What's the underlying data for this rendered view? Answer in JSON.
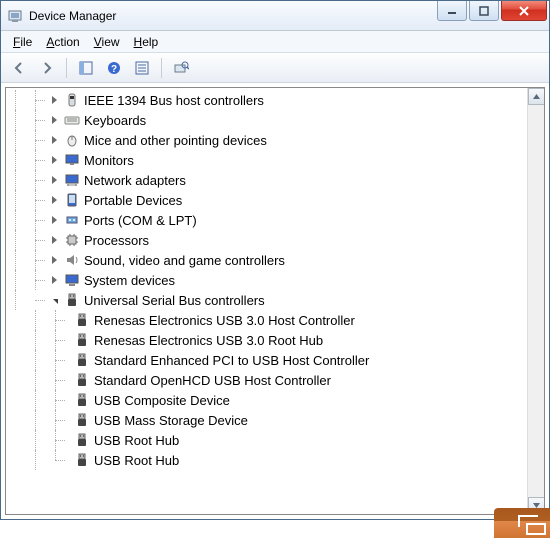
{
  "window": {
    "title": "Device Manager"
  },
  "menu": {
    "file": "File",
    "action": "Action",
    "view": "View",
    "help": "Help"
  },
  "toolbar": {
    "back": "back",
    "forward": "forward",
    "up": "show-hide-console-tree",
    "help2": "help",
    "props": "properties",
    "scan": "scan"
  },
  "tree": {
    "top": [
      {
        "label": "IEEE 1394 Bus host controllers",
        "icon": "ieee1394-icon"
      },
      {
        "label": "Keyboards",
        "icon": "keyboard-icon"
      },
      {
        "label": "Mice and other pointing devices",
        "icon": "mouse-icon"
      },
      {
        "label": "Monitors",
        "icon": "monitor-icon"
      },
      {
        "label": "Network adapters",
        "icon": "network-icon"
      },
      {
        "label": "Portable Devices",
        "icon": "portable-icon"
      },
      {
        "label": "Ports (COM & LPT)",
        "icon": "port-icon"
      },
      {
        "label": "Processors",
        "icon": "processor-icon"
      },
      {
        "label": "Sound, video and game controllers",
        "icon": "sound-icon"
      },
      {
        "label": "System devices",
        "icon": "system-icon"
      }
    ],
    "usb_category": {
      "label": "Universal Serial Bus controllers",
      "icon": "usb-icon"
    },
    "usb_children": [
      {
        "label": "Renesas Electronics USB 3.0 Host Controller"
      },
      {
        "label": "Renesas Electronics USB 3.0 Root Hub"
      },
      {
        "label": "Standard Enhanced PCI to USB Host Controller"
      },
      {
        "label": "Standard OpenHCD USB Host Controller"
      },
      {
        "label": "USB Composite Device"
      },
      {
        "label": "USB Mass Storage Device"
      },
      {
        "label": "USB Root Hub"
      },
      {
        "label": "USB Root Hub"
      }
    ]
  }
}
